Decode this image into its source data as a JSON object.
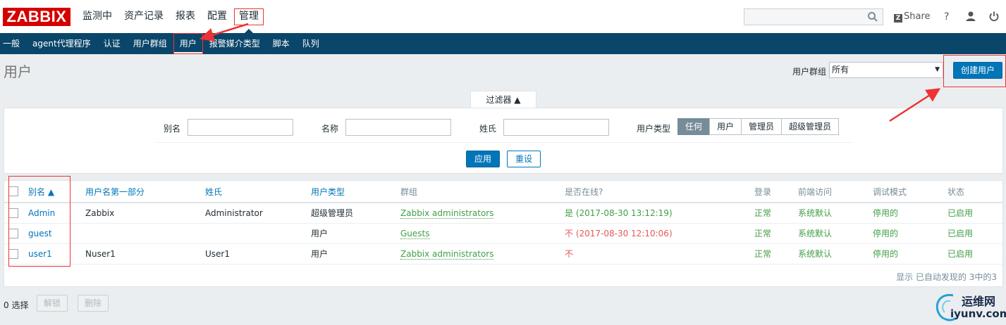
{
  "header": {
    "logo": "ZABBIX",
    "menu": [
      {
        "label": "监测中"
      },
      {
        "label": "资产记录"
      },
      {
        "label": "报表"
      },
      {
        "label": "配置"
      },
      {
        "label": "管理"
      }
    ],
    "share_label": "Share"
  },
  "submenu": [
    {
      "label": "一般"
    },
    {
      "label": "agent代理程序"
    },
    {
      "label": "认证"
    },
    {
      "label": "用户群组"
    },
    {
      "label": "用户"
    },
    {
      "label": "报警媒介类型"
    },
    {
      "label": "脚本"
    },
    {
      "label": "队列"
    }
  ],
  "page": {
    "title": "用户",
    "group_label": "用户群组",
    "group_value": "所有",
    "create_button": "创建用户"
  },
  "filter": {
    "tab_label": "过滤器 ▲",
    "alias_label": "别名",
    "name_label": "名称",
    "surname_label": "姓氏",
    "type_label": "用户类型",
    "type_options": [
      "任何",
      "用户",
      "管理员",
      "超级管理员"
    ],
    "apply": "应用",
    "reset": "重设"
  },
  "table": {
    "headers": [
      "别名 ▲",
      "用户名第一部分",
      "姓氏",
      "用户类型",
      "群组",
      "是否在线?",
      "登录",
      "前端访问",
      "调试模式",
      "状态"
    ],
    "rows": [
      {
        "alias": "Admin",
        "name": "Zabbix",
        "surname": "Administrator",
        "type": "超级管理员",
        "group": "Zabbix administrators",
        "online": "是 (2017-08-30 13:12:19)",
        "online_status": "yes",
        "login": "正常",
        "frontend": "系统默认",
        "debug": "停用的",
        "status": "已启用"
      },
      {
        "alias": "guest",
        "name": "",
        "surname": "",
        "type": "用户",
        "group": "Guests",
        "online": "不 (2017-08-30 12:10:06)",
        "online_status": "no",
        "login": "正常",
        "frontend": "系统默认",
        "debug": "停用的",
        "status": "已启用"
      },
      {
        "alias": "user1",
        "name": "Nuser1",
        "surname": "User1",
        "type": "用户",
        "group": "Zabbix administrators",
        "online": "不",
        "online_status": "no",
        "login": "正常",
        "frontend": "系统默认",
        "debug": "停用的",
        "status": "已启用"
      }
    ],
    "footer": "显示 已自动发现的 3中的3"
  },
  "bottom": {
    "selected": "0 选择",
    "unlock": "解锁",
    "delete": "删除"
  },
  "watermark": {
    "line1": "运维网",
    "line2": "iyunv.com"
  },
  "colors": {
    "brand_red": "#d40000",
    "nav_blue": "#0a466a",
    "primary_button": "#0275b8",
    "ok_green": "#429e47",
    "offline_red": "#e45959",
    "annotation_red": "#ee3333"
  }
}
